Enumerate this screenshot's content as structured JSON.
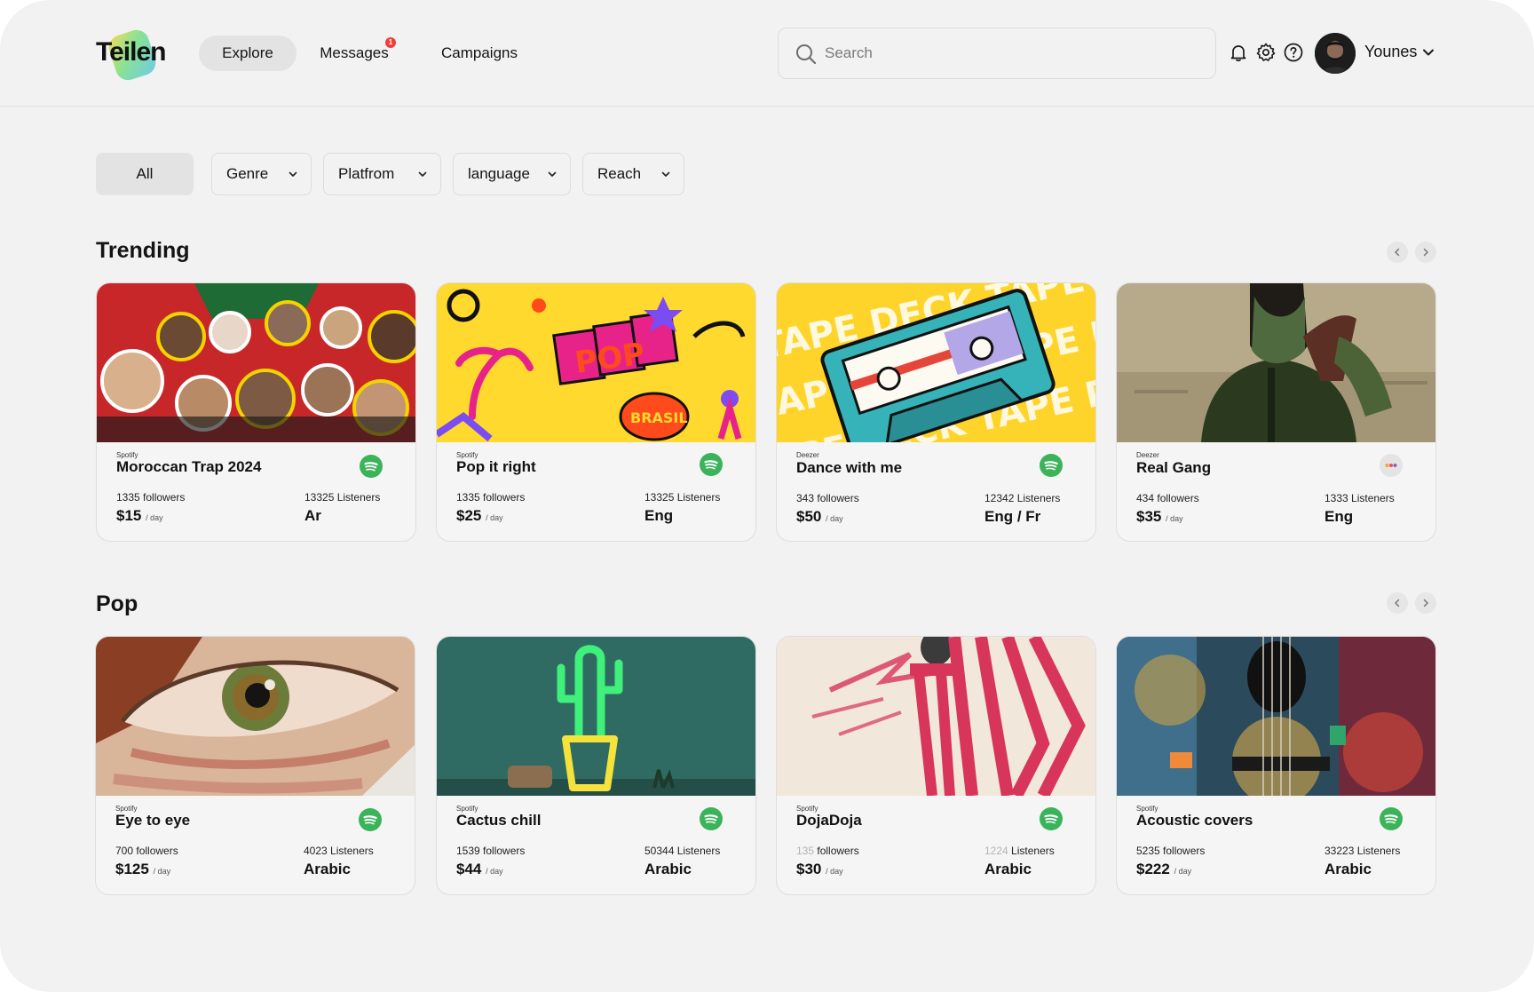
{
  "brand": {
    "name": "Teilen"
  },
  "nav": {
    "explore": "Explore",
    "messages": "Messages",
    "messages_badge": "1",
    "campaigns": "Campaigns"
  },
  "search": {
    "placeholder": "Search"
  },
  "header_icons": [
    "bell-icon",
    "gear-icon",
    "help-icon"
  ],
  "user": {
    "name": "Younes"
  },
  "filters": {
    "all": "All",
    "genre": "Genre",
    "platform": "Platfrom",
    "language": "language",
    "reach": "Reach"
  },
  "colors": {
    "background": "#f2f2f2",
    "active_pill": "#e3e3e3",
    "spotify_green": "#3bb35a",
    "badge_red": "#ef3e36"
  },
  "sections": [
    {
      "title": "Trending",
      "cards": [
        {
          "platform": "Spotify",
          "title": "Moroccan Trap 2024",
          "followers_count": "1335",
          "followers_label": "followers",
          "listeners_count": "13325",
          "listeners_label": "Listeners",
          "price": "$15",
          "per_day": "/ day",
          "language": "Ar",
          "platform_icon": "spotify-icon"
        },
        {
          "platform": "Spotify",
          "title": "Pop it right",
          "followers_count": "1335",
          "followers_label": "followers",
          "listeners_count": "13325",
          "listeners_label": "Listeners",
          "price": "$25",
          "per_day": "/ day",
          "language": "Eng",
          "platform_icon": "spotify-icon"
        },
        {
          "platform": "Deezer",
          "title": "Dance with me",
          "followers_count": "343",
          "followers_label": "followers",
          "listeners_count": "12342",
          "listeners_label": "Listeners",
          "price": "$50",
          "per_day": "/ day",
          "language": "Eng / Fr",
          "platform_icon": "spotify-icon"
        },
        {
          "platform": "Deezer",
          "title": "Real Gang",
          "followers_count": "434",
          "followers_label": "followers",
          "listeners_count": "1333",
          "listeners_label": "Listeners",
          "price": "$35",
          "per_day": "/ day",
          "language": "Eng",
          "platform_icon": "deezer-icon"
        }
      ]
    },
    {
      "title": "Pop",
      "cards": [
        {
          "platform": "Spotify",
          "title": "Eye to eye",
          "followers_count": "700",
          "followers_label": "followers",
          "listeners_count": "4023",
          "listeners_label": "Listeners",
          "price": "$125",
          "per_day": "/ day",
          "language": "Arabic",
          "platform_icon": "spotify-icon"
        },
        {
          "platform": "Spotify",
          "title": "Cactus chill",
          "followers_count": "1539",
          "followers_label": "followers",
          "listeners_count": "50344",
          "listeners_label": "Listeners",
          "price": "$44",
          "per_day": "/ day",
          "language": "Arabic",
          "platform_icon": "spotify-icon"
        },
        {
          "platform": "Spotify",
          "title": "DojaDoja",
          "followers_count": "135",
          "followers_label": "followers",
          "listeners_count": "1224",
          "listeners_label": "Listeners",
          "price": "$30",
          "per_day": "/ day",
          "language": "Arabic",
          "platform_icon": "spotify-icon"
        },
        {
          "platform": "Spotify",
          "title": "Acoustic covers",
          "followers_count": "5235",
          "followers_label": "followers",
          "listeners_count": "33223",
          "listeners_label": "Listeners",
          "price": "$222",
          "per_day": "/ day",
          "language": "Arabic",
          "platform_icon": "spotify-icon"
        }
      ]
    }
  ]
}
